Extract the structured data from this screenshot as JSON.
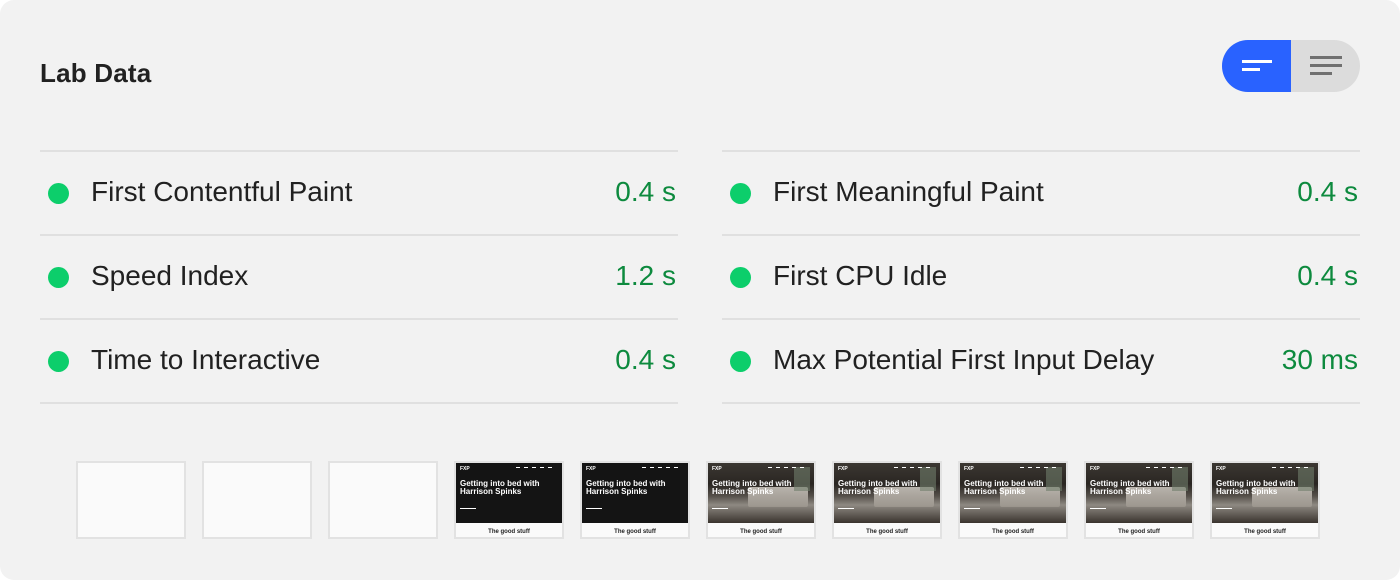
{
  "section": {
    "title": "Lab Data"
  },
  "view_toggle": {
    "options": [
      {
        "name": "summary-view",
        "icon": "summary-lines-icon",
        "active": true
      },
      {
        "name": "detailed-view",
        "icon": "detailed-lines-icon",
        "active": false
      }
    ],
    "active_color": "#2962ff"
  },
  "metrics": {
    "left": [
      {
        "label": "First Contentful Paint",
        "value": "0.4 s",
        "status": "pass"
      },
      {
        "label": "Speed Index",
        "value": "1.2 s",
        "status": "pass"
      },
      {
        "label": "Time to Interactive",
        "value": "0.4 s",
        "status": "pass"
      }
    ],
    "right": [
      {
        "label": "First Meaningful Paint",
        "value": "0.4 s",
        "status": "pass"
      },
      {
        "label": "First CPU Idle",
        "value": "0.4 s",
        "status": "pass"
      },
      {
        "label": "Max Potential First Input Delay",
        "value": "30 ms",
        "status": "pass"
      }
    ]
  },
  "colors": {
    "pass_dot": "#0cce6b",
    "pass_value": "#0d8a3e"
  },
  "filmstrip": {
    "frames": [
      {
        "type": "blank"
      },
      {
        "type": "blank"
      },
      {
        "type": "blank"
      },
      {
        "type": "dark",
        "logo": "FXP",
        "headline": "Getting into bed with Harrison Spinks",
        "caption": "The good stuff"
      },
      {
        "type": "dark",
        "logo": "FXP",
        "headline": "Getting into bed with Harrison Spinks",
        "caption": "The good stuff"
      },
      {
        "type": "photo",
        "logo": "FXP",
        "headline": "Getting into bed with Harrison Spinks",
        "caption": "The good stuff"
      },
      {
        "type": "photo",
        "logo": "FXP",
        "headline": "Getting into bed with Harrison Spinks",
        "caption": "The good stuff"
      },
      {
        "type": "photo",
        "logo": "FXP",
        "headline": "Getting into bed with Harrison Spinks",
        "caption": "The good stuff"
      },
      {
        "type": "photo",
        "logo": "FXP",
        "headline": "Getting into bed with Harrison Spinks",
        "caption": "The good stuff"
      },
      {
        "type": "photo",
        "logo": "FXP",
        "headline": "Getting into bed with Harrison Spinks",
        "caption": "The good stuff"
      }
    ]
  }
}
